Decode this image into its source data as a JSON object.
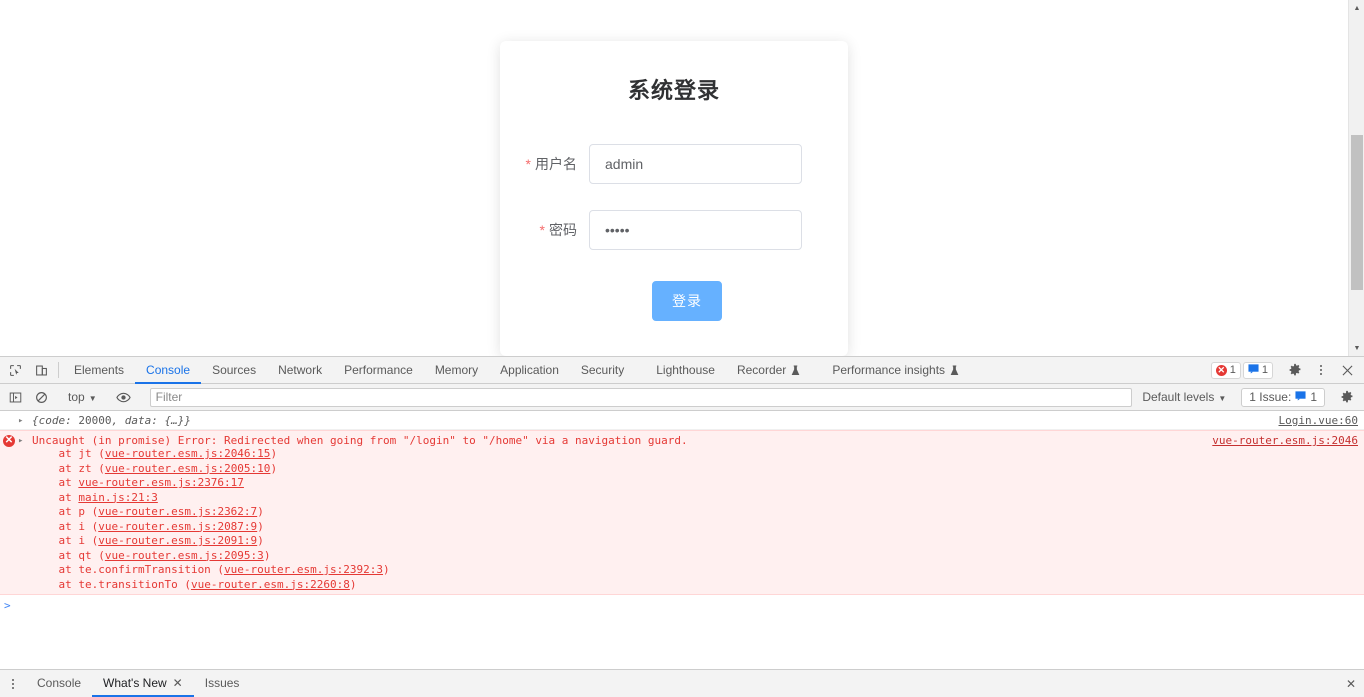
{
  "page": {
    "login_card": {
      "title": "系统登录",
      "fields": [
        {
          "required_mark": "*",
          "label": "用户名",
          "value": "admin",
          "placeholder": ""
        },
        {
          "required_mark": "*",
          "label": "密码",
          "value": "•••••",
          "placeholder": ""
        }
      ],
      "submit_label": "登录",
      "accent_color": "#66b1ff",
      "required_color": "#f56c6c"
    }
  },
  "devtools": {
    "tabs": [
      {
        "label": "Elements",
        "active": false,
        "flask": false
      },
      {
        "label": "Console",
        "active": true,
        "flask": false
      },
      {
        "label": "Sources",
        "active": false,
        "flask": false
      },
      {
        "label": "Network",
        "active": false,
        "flask": false
      },
      {
        "label": "Performance",
        "active": false,
        "flask": false
      },
      {
        "label": "Memory",
        "active": false,
        "flask": false
      },
      {
        "label": "Application",
        "active": false,
        "flask": false
      },
      {
        "label": "Security",
        "active": false,
        "flask": false
      },
      {
        "label": "Lighthouse",
        "active": false,
        "flask": false
      },
      {
        "label": "Recorder",
        "active": false,
        "flask": true
      },
      {
        "label": "Performance insights",
        "active": false,
        "flask": true
      }
    ],
    "status_badges": {
      "error_count": "1",
      "message_count": "1"
    },
    "toolbar": {
      "context": "top",
      "filter_placeholder": "Filter",
      "filter_value": "",
      "levels_label": "Default levels",
      "issues_label": "1 Issue:",
      "issues_count": "1"
    },
    "console": {
      "messages": [
        {
          "type": "info",
          "disclosure": "▸",
          "prefix": "{code: ",
          "number": "20000",
          "suffix": ", data: {…}}",
          "source": "Login.vue:60"
        },
        {
          "type": "error",
          "disclosure": "▸",
          "text": "Uncaught (in promise) Error: Redirected when going from \"/login\" to \"/home\" via a navigation guard.",
          "source": "vue-router.esm.js:2046",
          "stack": [
            {
              "prefix": "    at jt (",
              "link": "vue-router.esm.js:2046:15",
              "suffix": ")"
            },
            {
              "prefix": "    at zt (",
              "link": "vue-router.esm.js:2005:10",
              "suffix": ")"
            },
            {
              "prefix": "    at ",
              "link": "vue-router.esm.js:2376:17",
              "suffix": ""
            },
            {
              "prefix": "    at ",
              "link": "main.js:21:3",
              "suffix": ""
            },
            {
              "prefix": "    at p (",
              "link": "vue-router.esm.js:2362:7",
              "suffix": ")"
            },
            {
              "prefix": "    at i (",
              "link": "vue-router.esm.js:2087:9",
              "suffix": ")"
            },
            {
              "prefix": "    at i (",
              "link": "vue-router.esm.js:2091:9",
              "suffix": ")"
            },
            {
              "prefix": "    at qt (",
              "link": "vue-router.esm.js:2095:3",
              "suffix": ")"
            },
            {
              "prefix": "    at te.confirmTransition (",
              "link": "vue-router.esm.js:2392:3",
              "suffix": ")"
            },
            {
              "prefix": "    at te.transitionTo (",
              "link": "vue-router.esm.js:2260:8",
              "suffix": ")"
            }
          ]
        }
      ],
      "prompt": ">"
    },
    "drawer": {
      "tabs": [
        {
          "label": "Console",
          "active": false,
          "closable": false
        },
        {
          "label": "What's New",
          "active": true,
          "closable": true,
          "close_glyph": "✕"
        },
        {
          "label": "Issues",
          "active": false,
          "closable": false
        }
      ],
      "close_glyph": "✕"
    }
  }
}
